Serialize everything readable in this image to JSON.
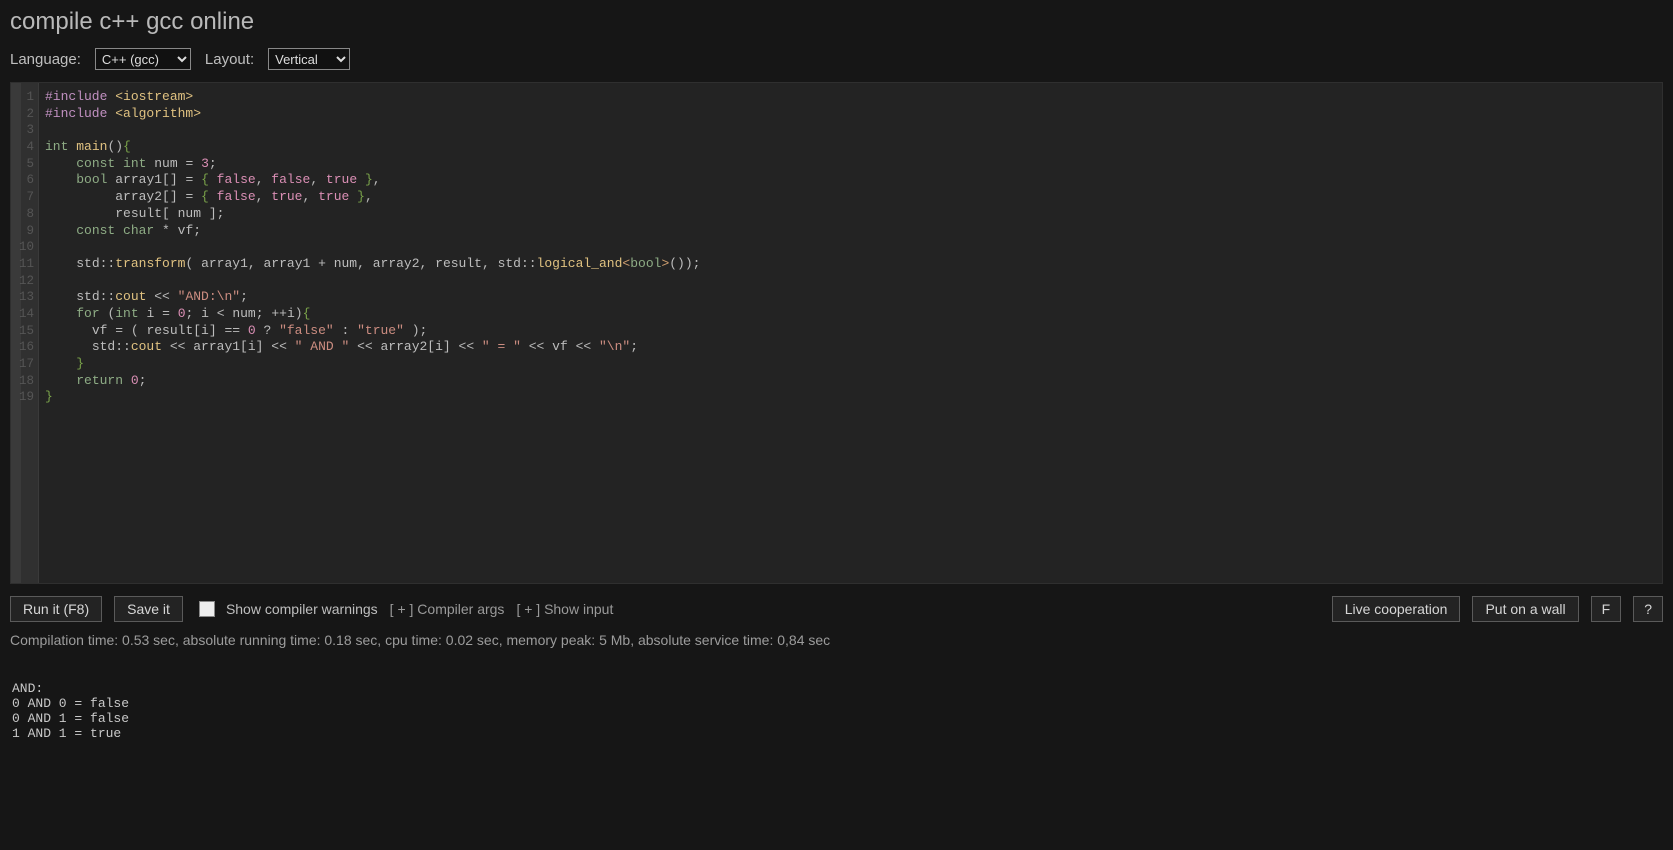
{
  "page": {
    "title": "compile c++ gcc online"
  },
  "toolbar": {
    "language_label": "Language:",
    "language_value": "C++ (gcc)",
    "language_options": [
      "C++ (gcc)"
    ],
    "layout_label": "Layout:",
    "layout_value": "Vertical",
    "layout_options": [
      "Vertical"
    ]
  },
  "editor": {
    "line_count": 19,
    "tokens": [
      [
        [
          "s-pp",
          "#include "
        ],
        [
          "s-inc",
          "<iostream>"
        ]
      ],
      [
        [
          "s-pp",
          "#include "
        ],
        [
          "s-inc",
          "<algorithm>"
        ]
      ],
      [],
      [
        [
          "s-kw",
          "int "
        ],
        [
          "s-fn",
          "main"
        ],
        [
          "s-pu",
          "()"
        ],
        [
          "s-br",
          "{"
        ]
      ],
      [
        [
          "",
          "    "
        ],
        [
          "s-kw",
          "const int "
        ],
        [
          "s-id",
          "num "
        ],
        [
          "s-op",
          "= "
        ],
        [
          "s-num",
          "3"
        ],
        [
          "s-pu",
          ";"
        ]
      ],
      [
        [
          "",
          "    "
        ],
        [
          "s-kw",
          "bool "
        ],
        [
          "s-id",
          "array1[] "
        ],
        [
          "s-op",
          "= "
        ],
        [
          "s-br",
          "{ "
        ],
        [
          "s-bool",
          "false"
        ],
        [
          "s-pu",
          ", "
        ],
        [
          "s-bool",
          "false"
        ],
        [
          "s-pu",
          ", "
        ],
        [
          "s-bool",
          "true"
        ],
        [
          "s-br",
          " }"
        ],
        [
          "s-pu",
          ","
        ]
      ],
      [
        [
          "",
          "         "
        ],
        [
          "s-id",
          "array2[] "
        ],
        [
          "s-op",
          "= "
        ],
        [
          "s-br",
          "{ "
        ],
        [
          "s-bool",
          "false"
        ],
        [
          "s-pu",
          ", "
        ],
        [
          "s-bool",
          "true"
        ],
        [
          "s-pu",
          ", "
        ],
        [
          "s-bool",
          "true"
        ],
        [
          "s-br",
          " }"
        ],
        [
          "s-pu",
          ","
        ]
      ],
      [
        [
          "",
          "         "
        ],
        [
          "s-id",
          "result[ num ]"
        ],
        [
          "s-pu",
          ";"
        ]
      ],
      [
        [
          "",
          "    "
        ],
        [
          "s-kw",
          "const char "
        ],
        [
          "s-op",
          "* "
        ],
        [
          "s-id",
          "vf"
        ],
        [
          "s-pu",
          ";"
        ]
      ],
      [],
      [
        [
          "",
          "    "
        ],
        [
          "s-id",
          "std"
        ],
        [
          "s-pu",
          "::"
        ],
        [
          "s-fn",
          "transform"
        ],
        [
          "s-pu",
          "( "
        ],
        [
          "s-id",
          "array1"
        ],
        [
          "s-pu",
          ", "
        ],
        [
          "s-id",
          "array1 "
        ],
        [
          "s-op",
          "+ "
        ],
        [
          "s-id",
          "num"
        ],
        [
          "s-pu",
          ", "
        ],
        [
          "s-id",
          "array2"
        ],
        [
          "s-pu",
          ", "
        ],
        [
          "s-id",
          "result"
        ],
        [
          "s-pu",
          ", "
        ],
        [
          "s-id",
          "std"
        ],
        [
          "s-pu",
          "::"
        ],
        [
          "s-fn",
          "logical_and"
        ],
        [
          "s-tm",
          "<"
        ],
        [
          "s-kw",
          "bool"
        ],
        [
          "s-tm",
          ">"
        ],
        [
          "s-pu",
          "());"
        ]
      ],
      [],
      [
        [
          "",
          "    "
        ],
        [
          "s-id",
          "std"
        ],
        [
          "s-pu",
          "::"
        ],
        [
          "s-fn",
          "cout "
        ],
        [
          "s-op",
          "<< "
        ],
        [
          "s-str",
          "\"AND:\\n\""
        ],
        [
          "s-pu",
          ";"
        ]
      ],
      [
        [
          "",
          "    "
        ],
        [
          "s-kw",
          "for "
        ],
        [
          "s-pu",
          "("
        ],
        [
          "s-kw",
          "int "
        ],
        [
          "s-id",
          "i "
        ],
        [
          "s-op",
          "= "
        ],
        [
          "s-num",
          "0"
        ],
        [
          "s-pu",
          "; "
        ],
        [
          "s-id",
          "i "
        ],
        [
          "s-op",
          "< "
        ],
        [
          "s-id",
          "num"
        ],
        [
          "s-pu",
          "; "
        ],
        [
          "s-op",
          "++"
        ],
        [
          "s-id",
          "i"
        ],
        [
          "s-pu",
          ")"
        ],
        [
          "s-br",
          "{"
        ]
      ],
      [
        [
          "",
          "      "
        ],
        [
          "s-id",
          "vf "
        ],
        [
          "s-op",
          "= "
        ],
        [
          "s-pu",
          "( "
        ],
        [
          "s-id",
          "result[i] "
        ],
        [
          "s-op",
          "== "
        ],
        [
          "s-num",
          "0"
        ],
        [
          "s-op",
          " ? "
        ],
        [
          "s-str",
          "\"false\""
        ],
        [
          "s-op",
          " : "
        ],
        [
          "s-str",
          "\"true\""
        ],
        [
          "s-pu",
          " );"
        ]
      ],
      [
        [
          "",
          "      "
        ],
        [
          "s-id",
          "std"
        ],
        [
          "s-pu",
          "::"
        ],
        [
          "s-fn",
          "cout "
        ],
        [
          "s-op",
          "<< "
        ],
        [
          "s-id",
          "array1[i] "
        ],
        [
          "s-op",
          "<< "
        ],
        [
          "s-str",
          "\" AND \""
        ],
        [
          "s-op",
          " << "
        ],
        [
          "s-id",
          "array2[i] "
        ],
        [
          "s-op",
          "<< "
        ],
        [
          "s-str",
          "\" = \""
        ],
        [
          "s-op",
          " << "
        ],
        [
          "s-id",
          "vf "
        ],
        [
          "s-op",
          "<< "
        ],
        [
          "s-str",
          "\"\\n\""
        ],
        [
          "s-pu",
          ";"
        ]
      ],
      [
        [
          "",
          "    "
        ],
        [
          "s-br",
          "}"
        ]
      ],
      [
        [
          "",
          "    "
        ],
        [
          "s-kw",
          "return "
        ],
        [
          "s-num",
          "0"
        ],
        [
          "s-pu",
          ";"
        ]
      ],
      [
        [
          "s-br",
          "}"
        ]
      ]
    ]
  },
  "actionbar": {
    "run_label": "Run it (F8)",
    "save_label": "Save it",
    "show_warnings_label": "Show compiler warnings",
    "show_warnings_checked": false,
    "compiler_args_toggle": "[ + ]",
    "compiler_args_label": "Compiler args",
    "show_input_toggle": "[ + ]",
    "show_input_label": "Show input",
    "live_coop_label": "Live cooperation",
    "wall_label": "Put on a wall",
    "fullscreen_label": "F",
    "help_label": "?"
  },
  "stats": {
    "text": "Compilation time: 0.53 sec, absolute running time: 0.18 sec, cpu time: 0.02 sec, memory peak: 5 Mb, absolute service time: 0,84 sec"
  },
  "output": {
    "lines": [
      "AND:",
      "0 AND 0 = false",
      "0 AND 1 = false",
      "1 AND 1 = true"
    ]
  }
}
